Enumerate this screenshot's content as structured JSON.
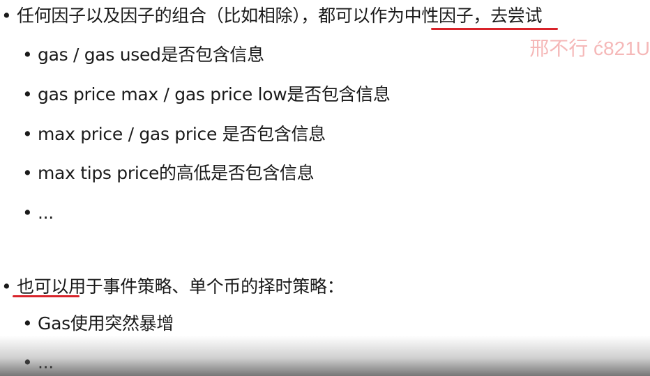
{
  "bullet_char": "•",
  "items": [
    {
      "pre": "任何因子以及因子的组合（比如相除），都可以",
      "hl": "作为中性因子",
      "post": "，去尝试"
    },
    {
      "text": "gas / gas used是否包含信息"
    },
    {
      "text": "gas price max / gas price low是否包含信息"
    },
    {
      "text": "max price / gas price 是否包含信息"
    },
    {
      "text": "max tips price的高低是否包含信息"
    },
    {
      "text": "..."
    },
    {
      "hl": "也可以",
      "post": "用于事件策略、单个币的择时策略："
    },
    {
      "text": "Gas使用突然暴增"
    },
    {
      "text": "..."
    }
  ],
  "watermark": "邢不行 ć821U",
  "colors": {
    "underline": "#d8232a",
    "watermark": "#f5b8b8",
    "text": "#1a1a1a"
  }
}
